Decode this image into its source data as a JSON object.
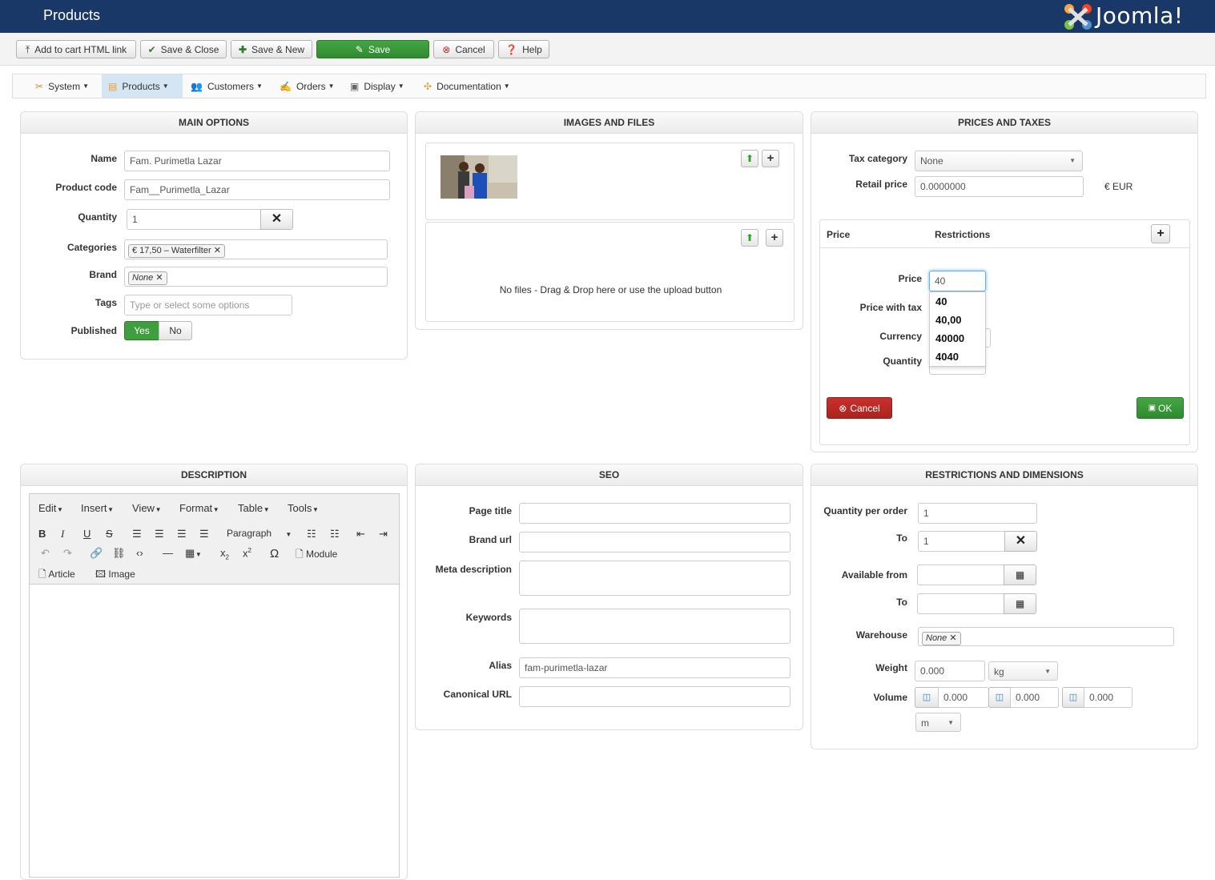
{
  "header": {
    "title": "Products",
    "logo_text": "Joomla!"
  },
  "toolbar": {
    "add_to_cart": "Add to cart HTML link",
    "save_close": "Save & Close",
    "save_new": "Save & New",
    "save": "Save",
    "cancel": "Cancel",
    "help": "Help"
  },
  "menu": {
    "system": "System",
    "products": "Products",
    "customers": "Customers",
    "orders": "Orders",
    "display": "Display",
    "documentation": "Documentation"
  },
  "main_options": {
    "heading": "MAIN OPTIONS",
    "name_label": "Name",
    "name_value": "Fam. Purimetla Lazar",
    "code_label": "Product code",
    "code_value": "Fam__Purimetla_Lazar",
    "quantity_label": "Quantity",
    "quantity_value": "1",
    "categories_label": "Categories",
    "category_chip": "€ 17,50 – Waterfilter",
    "brand_label": "Brand",
    "brand_chip": "None",
    "tags_label": "Tags",
    "tags_placeholder": "Type or select some options",
    "published_label": "Published",
    "published_yes": "Yes",
    "published_no": "No"
  },
  "images": {
    "heading": "IMAGES AND FILES",
    "no_files": "No files - Drag & Drop here or use the upload button"
  },
  "prices": {
    "heading": "PRICES AND TAXES",
    "tax_label": "Tax category",
    "tax_value": "None",
    "retail_label": "Retail price",
    "retail_value": "0.0000000",
    "currency_suffix": "€ EUR",
    "col_price": "Price",
    "col_restrictions": "Restrictions",
    "price_label": "Price",
    "price_value": "40",
    "price_tax_label": "Price with tax",
    "currency_label": "Currency",
    "quantity_label": "Quantity",
    "autocomplete": [
      "40",
      "40,00",
      "40000",
      "4040"
    ],
    "cancel": "Cancel",
    "ok": "OK"
  },
  "description": {
    "heading": "DESCRIPTION",
    "menus": [
      "Edit",
      "Insert",
      "View",
      "Format",
      "Table",
      "Tools"
    ],
    "paragraph": "Paragraph",
    "module": "Module",
    "article": "Article",
    "image": "Image"
  },
  "seo": {
    "heading": "SEO",
    "page_title_label": "Page title",
    "brand_url_label": "Brand url",
    "meta_label": "Meta description",
    "keywords_label": "Keywords",
    "alias_label": "Alias",
    "alias_value": "fam-purimetla-lazar",
    "canonical_label": "Canonical URL"
  },
  "restrictions": {
    "heading": "RESTRICTIONS AND DIMENSIONS",
    "qpo_label": "Quantity per order",
    "qpo_value": "1",
    "to_label": "To",
    "to_value": "1",
    "avail_label": "Available from",
    "to2_label": "To",
    "warehouse_label": "Warehouse",
    "warehouse_chip": "None",
    "weight_label": "Weight",
    "weight_value": "0.000",
    "weight_unit": "kg",
    "volume_label": "Volume",
    "vol1": "0.000",
    "vol2": "0.000",
    "vol3": "0.000",
    "volume_unit": "m"
  },
  "colors": {
    "header_bg": "#1a3867",
    "save_green": "#3f9f3f",
    "cancel_red": "#bd2a2a",
    "active_menu": "#d4e6f4"
  }
}
